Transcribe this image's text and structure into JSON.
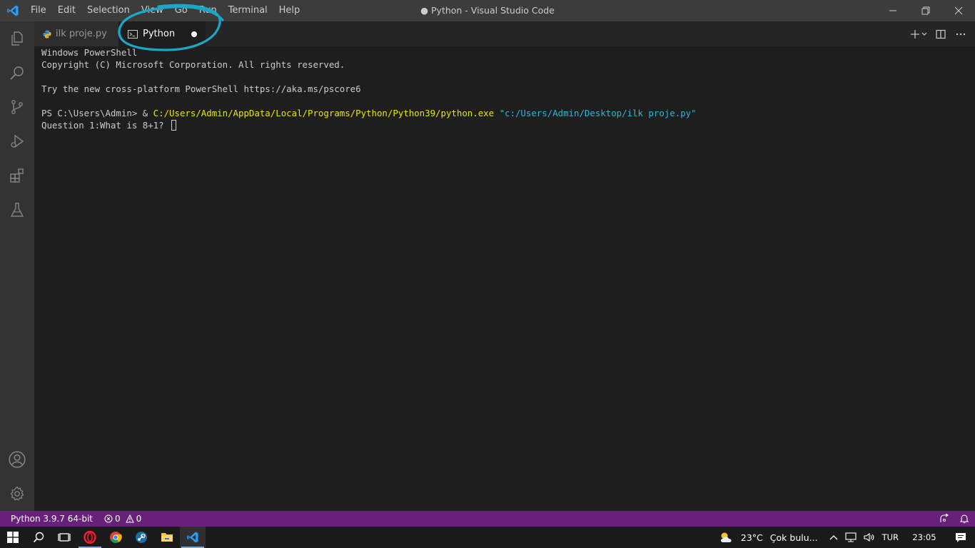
{
  "window": {
    "title": "● Python - Visual Studio Code"
  },
  "menu": [
    "File",
    "Edit",
    "Selection",
    "View",
    "Go",
    "Run",
    "Terminal",
    "Help"
  ],
  "tabs": [
    {
      "label": "ilk proje.py",
      "icon": "python-file-icon",
      "active": false
    },
    {
      "label": "Python",
      "icon": "terminal-icon",
      "active": true,
      "dirty": true
    }
  ],
  "terminal": {
    "lines": [
      "Windows PowerShell",
      "Copyright (C) Microsoft Corporation. All rights reserved.",
      "",
      "Try the new cross-platform PowerShell https://aka.ms/pscore6",
      ""
    ],
    "prompt": "PS C:\\Users\\Admin> & ",
    "exe_path": "C:/Users/Admin/AppData/Local/Programs/Python/Python39/python.exe",
    "script_arg": "\"c:/Users/Admin/Desktop/ilk proje.py\"",
    "question": "Question 1:What is 8+1? "
  },
  "statusbar": {
    "interpreter": "Python 3.9.7 64-bit",
    "errors": "0",
    "warnings": "0"
  },
  "taskbar": {
    "weather_temp": "23°C",
    "weather_desc": "Çok bulu...",
    "language": "TUR",
    "time": "23:05"
  },
  "colors": {
    "statusbar_bg": "#68217a",
    "terminal_yellow": "#e5e510",
    "terminal_cyan": "#29b8db",
    "annotation": "#1aa7c8"
  }
}
